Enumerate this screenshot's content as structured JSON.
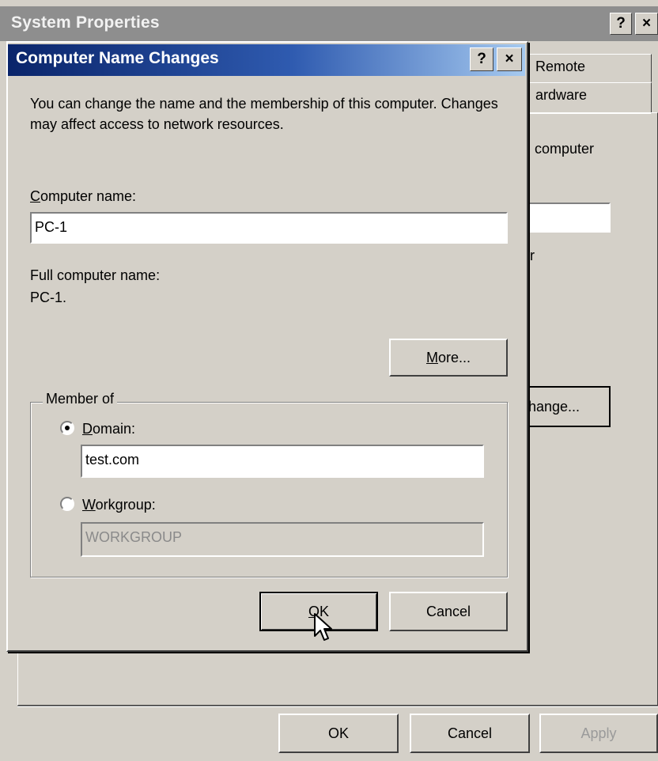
{
  "system_properties": {
    "title": "System Properties",
    "help_glyph": "?",
    "close_glyph": "×",
    "tabs": [
      {
        "label": "Remote"
      },
      {
        "label": "ardware"
      }
    ],
    "fragments": {
      "computer_text": "computer",
      "r_text": "r",
      "change_button": "hange..."
    },
    "buttons": {
      "ok": "OK",
      "cancel": "Cancel",
      "apply": "Apply"
    }
  },
  "dialog": {
    "title": "Computer Name Changes",
    "help_glyph": "?",
    "close_glyph": "×",
    "description": "You can change the name and the membership of this computer. Changes may affect access to network resources.",
    "computer_name": {
      "label_accel": "C",
      "label_rest": "omputer name:",
      "value": "PC-1"
    },
    "full_computer_name": {
      "label": "Full computer name:",
      "value": "PC-1."
    },
    "more_button": {
      "accel": "M",
      "rest": "ore..."
    },
    "member_of": {
      "label": "Member of",
      "selected": "domain",
      "domain": {
        "accel": "D",
        "rest": "omain:",
        "value": "test.com"
      },
      "workgroup": {
        "accel": "W",
        "rest": "orkgroup:",
        "value": "WORKGROUP"
      }
    },
    "ok_button": {
      "accel": "O",
      "rest": "K"
    },
    "cancel_button": "Cancel"
  },
  "colors": {
    "dialog_title_gradient_start": "#0a246a",
    "dialog_title_gradient_end": "#a6caf0",
    "window_face": "#d4d0c8",
    "inactive_title": "#8e8e8e"
  },
  "cursor": {
    "icon": "arrow-pointer"
  }
}
